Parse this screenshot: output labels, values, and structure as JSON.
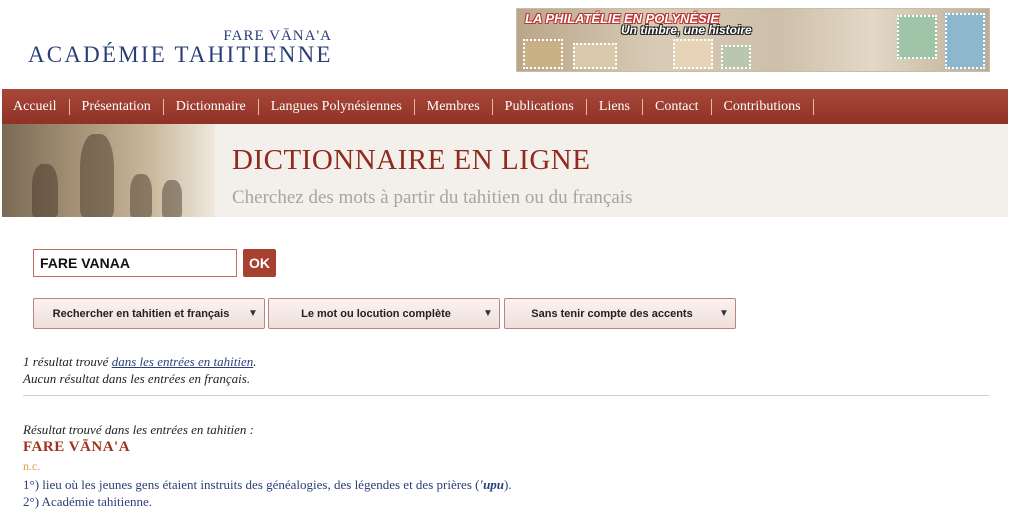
{
  "logo": {
    "top": "FARE VĀNA'A",
    "main": "ACADÉMIE TAHITIENNE"
  },
  "banner": {
    "title": "LA PHILATÉLIE EN POLYNÉSIE",
    "subtitle": "Un timbre, une histoire"
  },
  "nav": {
    "items": [
      {
        "label": "Accueil"
      },
      {
        "label": "Présentation"
      },
      {
        "label": "Dictionnaire"
      },
      {
        "label": "Langues Polynésiennes"
      },
      {
        "label": "Membres"
      },
      {
        "label": "Publications"
      },
      {
        "label": "Liens"
      },
      {
        "label": "Contact"
      },
      {
        "label": "Contributions"
      }
    ]
  },
  "hero": {
    "title": "DICTIONNAIRE EN LIGNE",
    "subtitle": "Cherchez des mots à partir du tahitien ou du français"
  },
  "search": {
    "value": "FARE VANAA",
    "ok_label": "OK"
  },
  "filters": {
    "language": "Rechercher en tahitien et français",
    "match": "Le mot ou locution complète",
    "accents": "Sans tenir compte des accents"
  },
  "results": {
    "summary_prefix": "1 résultat trouvé ",
    "summary_link": "dans les entrées en tahitien",
    "summary_suffix": ".",
    "none_french": "Aucun résultat dans les entrées en français.",
    "heading": "Résultat trouvé dans les entrées en tahitien :",
    "entry": {
      "word": "FARE VĀNA'A",
      "pos": "n.c.",
      "def1_prefix": "1°) lieu où les jeunes gens étaient instruits des généalogies, des légendes et des prières (",
      "def1_em": "'upu",
      "def1_suffix": ").",
      "def2": "2°) Académie tahitienne."
    }
  }
}
